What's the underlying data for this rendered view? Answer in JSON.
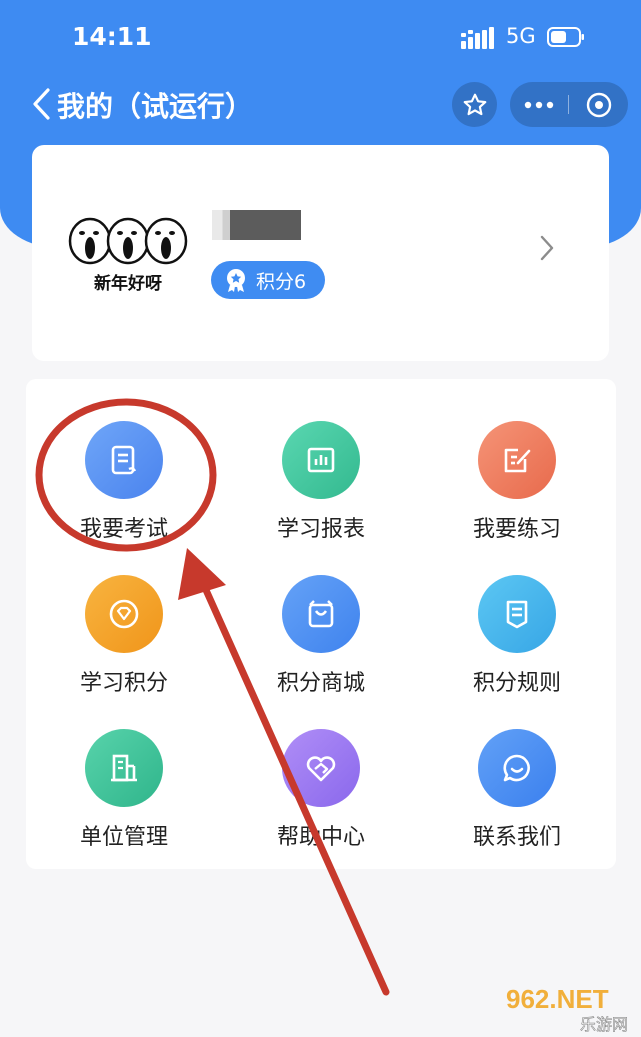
{
  "status_bar": {
    "time": "14:11",
    "network": "5G"
  },
  "nav": {
    "title": "我的（试运行）"
  },
  "profile": {
    "avatar_caption": "新年好呀",
    "points_label": "积分6"
  },
  "grid": {
    "items": [
      {
        "label": "我要考试",
        "icon": "exam-document-icon",
        "color": "#5b95f6"
      },
      {
        "label": "学习报表",
        "icon": "report-chart-icon",
        "color": "#3ec7a0"
      },
      {
        "label": "我要练习",
        "icon": "practice-edit-icon",
        "color": "#f07a5a"
      },
      {
        "label": "学习积分",
        "icon": "points-diamond-icon",
        "color": "#f5a623"
      },
      {
        "label": "积分商城",
        "icon": "shopping-bag-icon",
        "color": "#4d8ff2"
      },
      {
        "label": "积分规则",
        "icon": "rules-scroll-icon",
        "color": "#43b6ec"
      },
      {
        "label": "单位管理",
        "icon": "building-icon",
        "color": "#3cc29b"
      },
      {
        "label": "帮助中心",
        "icon": "help-heart-icon",
        "color": "#9b7cf0"
      },
      {
        "label": "联系我们",
        "icon": "chat-bubble-icon",
        "color": "#4b8ef3"
      }
    ]
  },
  "watermark": {
    "text_top": "962.NET",
    "text_bottom": "乐游网"
  },
  "colors": {
    "header_blue": "#3e8bf2",
    "annotation_red": "#c7392c"
  }
}
